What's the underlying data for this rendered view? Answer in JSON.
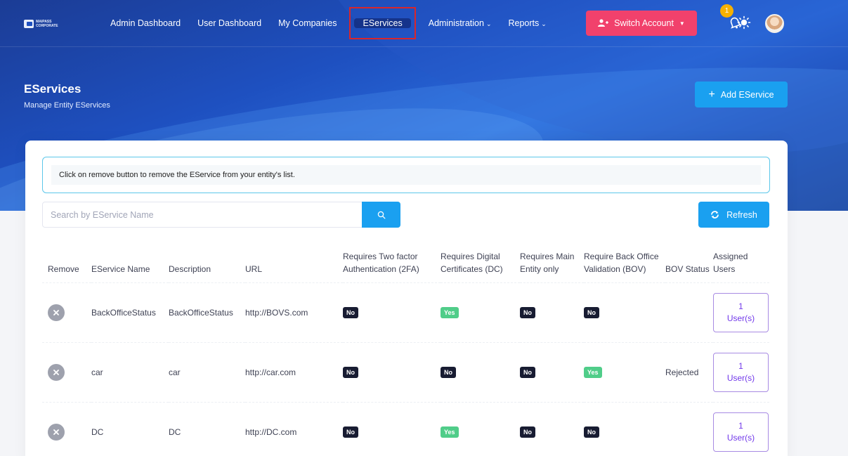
{
  "nav": {
    "items": [
      {
        "label": "Admin Dashboard"
      },
      {
        "label": "User Dashboard"
      },
      {
        "label": "My Companies"
      },
      {
        "label": "EServices"
      },
      {
        "label": "Administration"
      },
      {
        "label": "Reports"
      }
    ],
    "active": "EServices",
    "switch_account_label": "Switch Account",
    "notification_count": "1",
    "logo_text": "MAIPASS CORPORATE"
  },
  "header": {
    "title": "EServices",
    "subtitle": "Manage Entity EServices",
    "add_button_label": "Add EService"
  },
  "alert": {
    "text": "Click on remove button to remove the EService from your entity's list."
  },
  "search": {
    "placeholder": "Search by EService Name",
    "value": ""
  },
  "refresh_label": "Refresh",
  "table": {
    "headers": [
      "Remove",
      "EService Name",
      "Description",
      "URL",
      "Requires Two factor Authentication (2FA)",
      "Requires Digital Certificates (DC)",
      "Requires Main Entity only",
      "Require Back Office Validation (BOV)",
      "BOV Status",
      "Assigned Users"
    ],
    "rows": [
      {
        "name": "BackOfficeStatus",
        "description": "BackOfficeStatus",
        "url": "http://BOVS.com",
        "twofa": "No",
        "dc": "Yes",
        "main": "No",
        "bov": "No",
        "bov_status": "",
        "users_count": "1",
        "users_label": "User(s)"
      },
      {
        "name": "car",
        "description": "car",
        "url": "http://car.com",
        "twofa": "No",
        "dc": "No",
        "main": "No",
        "bov": "Yes",
        "bov_status": "Rejected",
        "users_count": "1",
        "users_label": "User(s)"
      },
      {
        "name": "DC",
        "description": "DC",
        "url": "http://DC.com",
        "twofa": "No",
        "dc": "Yes",
        "main": "No",
        "bov": "No",
        "bov_status": "",
        "users_count": "1",
        "users_label": "User(s)"
      }
    ]
  },
  "colors": {
    "primary": "#1aa0f0",
    "switch": "#f1416c",
    "yes": "#50cd89",
    "no": "#181c32",
    "users": "#7239ea",
    "highlight": "#d9262b"
  }
}
